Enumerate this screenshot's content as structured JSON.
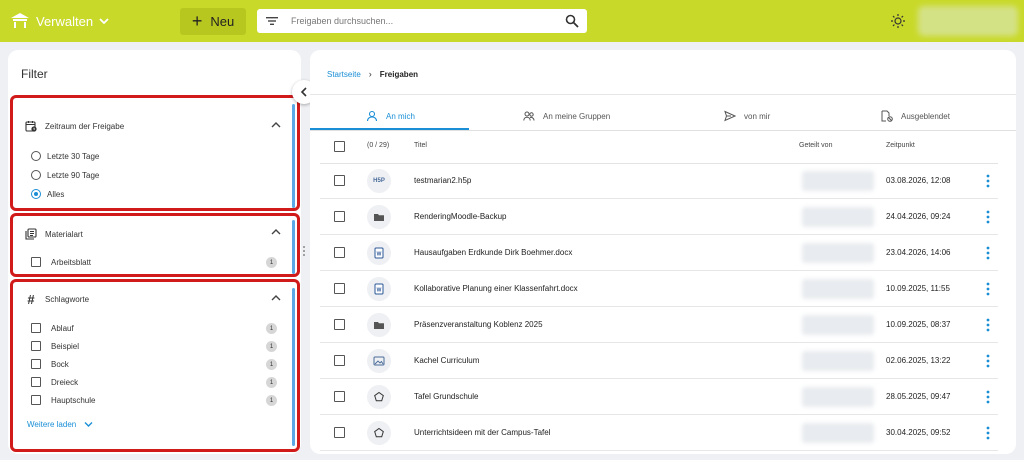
{
  "topbar": {
    "brand": "Verwalten",
    "new_label": "Neu",
    "search_placeholder": "Freigaben durchsuchen..."
  },
  "filter": {
    "title": "Filter",
    "period": {
      "heading": "Zeitraum der Freigabe",
      "options": [
        "Letzte 30 Tage",
        "Letzte 90 Tage",
        "Alles"
      ],
      "selected": "Alles"
    },
    "material": {
      "heading": "Materialart",
      "items": [
        {
          "label": "Arbeitsblatt",
          "count": "1"
        }
      ]
    },
    "tags": {
      "heading": "Schlagworte",
      "items": [
        {
          "label": "Ablauf",
          "count": "1"
        },
        {
          "label": "Beispiel",
          "count": "1"
        },
        {
          "label": "Bock",
          "count": "1"
        },
        {
          "label": "Dreieck",
          "count": "1"
        },
        {
          "label": "Hauptschule",
          "count": "1"
        }
      ],
      "more_label": "Weitere laden"
    }
  },
  "breadcrumb": {
    "home": "Startseite",
    "current": "Freigaben"
  },
  "tabs": [
    "An mich",
    "An meine Gruppen",
    "von mir",
    "Ausgeblendet"
  ],
  "table": {
    "count_label": "(0 / 29)",
    "headers": {
      "title": "Titel",
      "shared_by": "Geteilt von",
      "time": "Zeitpunkt"
    },
    "rows": [
      {
        "icon": "h5p-icon",
        "icon_text": "H5P",
        "title": "testmarian2.h5p",
        "time": "03.08.2026, 12:08"
      },
      {
        "icon": "folder-icon",
        "icon_text": "",
        "title": "RenderingMoodle-Backup",
        "time": "24.04.2026, 09:24"
      },
      {
        "icon": "word-doc-icon",
        "icon_text": "",
        "title": "Hausaufgaben Erdkunde Dirk Boehmer.docx",
        "time": "23.04.2026, 14:06"
      },
      {
        "icon": "word-doc-icon",
        "icon_text": "",
        "title": "Kollaborative Planung einer Klassenfahrt.docx",
        "time": "10.09.2025, 11:55"
      },
      {
        "icon": "folder-icon",
        "icon_text": "",
        "title": "Präsenzveranstaltung Koblenz 2025",
        "time": "10.09.2025, 08:37"
      },
      {
        "icon": "image-icon",
        "icon_text": "",
        "title": "Kachel Curriculum",
        "time": "02.06.2025, 13:22"
      },
      {
        "icon": "board-icon",
        "icon_text": "",
        "title": "Tafel Grundschule",
        "time": "28.05.2025, 09:47"
      },
      {
        "icon": "board-icon",
        "icon_text": "",
        "title": "Unterrichtsideen mit der Campus-Tafel",
        "time": "30.04.2025, 09:52"
      }
    ]
  }
}
